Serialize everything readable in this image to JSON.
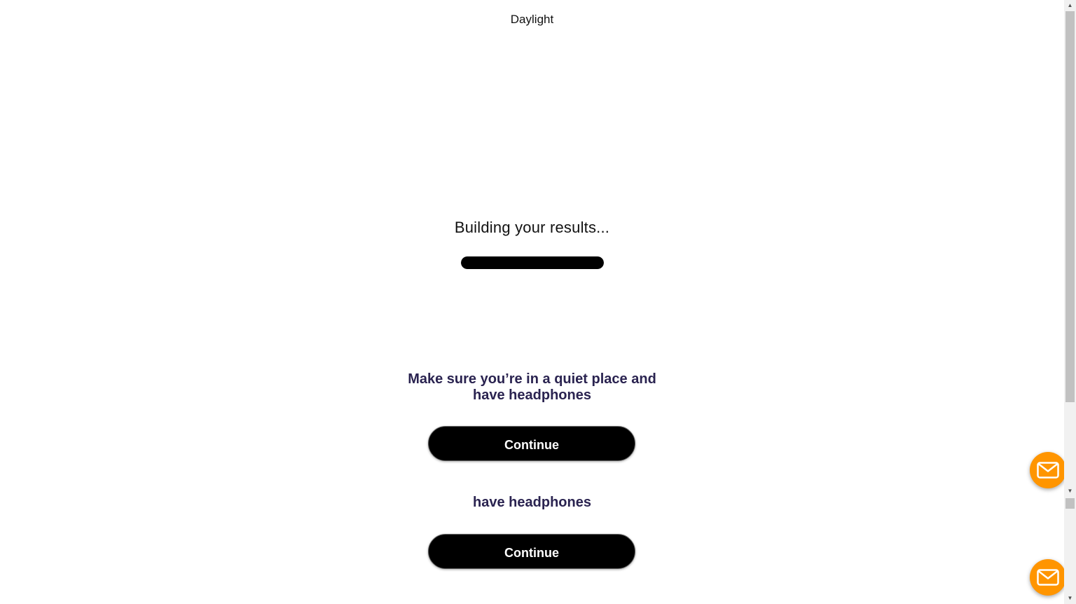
{
  "header": {
    "brand": "Daylight"
  },
  "loading": {
    "title": "Building your results...",
    "progress_percent": 100
  },
  "prompts": [
    {
      "line1": "Make sure you’re in a quiet place and",
      "line2": "have headphones",
      "button_label": "Continue"
    },
    {
      "line2": "have headphones",
      "button_label": "Continue"
    }
  ],
  "mail_fab": {
    "icon": "mail-icon",
    "color": "#ff9500"
  },
  "colors": {
    "prompt_text": "#2a2350",
    "button_bg": "#000000",
    "button_text": "#ffffff",
    "progress_fill": "#000000"
  }
}
